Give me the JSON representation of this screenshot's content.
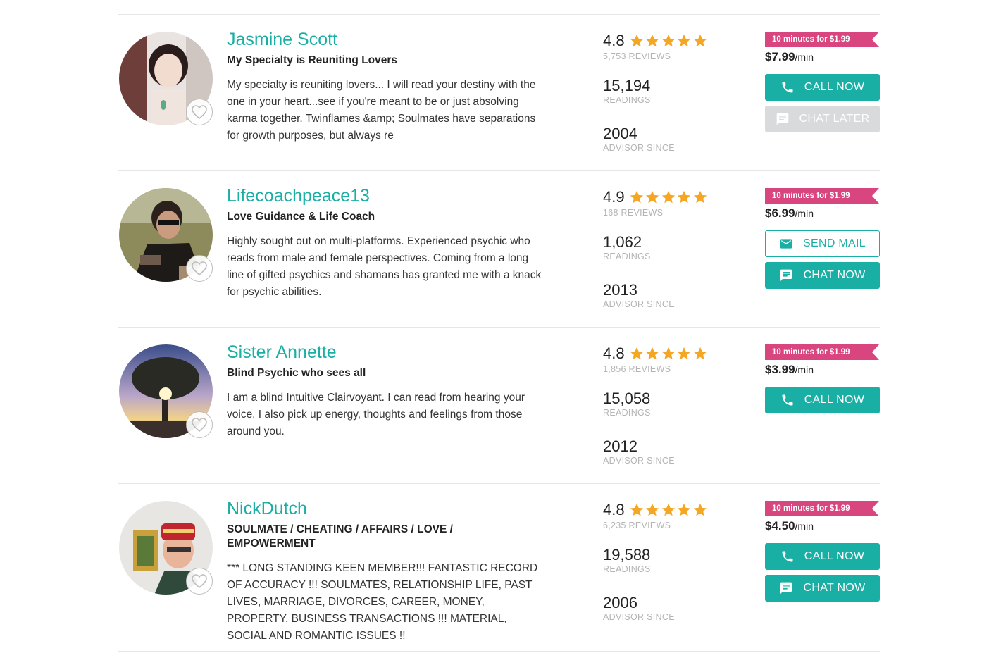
{
  "colors": {
    "accent": "#1aafa5",
    "promo": "#d9467f",
    "star": "#f5a623",
    "disabled": "#d9dadc"
  },
  "labels": {
    "reviews_suffix": "REVIEWS",
    "readings": "READINGS",
    "advisor_since": "ADVISOR SINCE",
    "per_min": "/min"
  },
  "advisors": [
    {
      "name": "Jasmine Scott",
      "specialty": "My Specialty is Reuniting Lovers",
      "description": "My specialty is reuniting lovers... I will read your destiny with the one in your heart...see if you're meant to be or just absolving karma together. Twinflames &amp; Soulmates have separations for growth purposes, but always re",
      "rating": "4.8",
      "reviews": "5,753 REVIEWS",
      "readings": "15,194",
      "since": "2004",
      "promo": "10 minutes for $1.99",
      "price": "$7.99",
      "buttons": [
        {
          "label": "CALL NOW",
          "icon": "phone-icon",
          "style": "primary"
        },
        {
          "label": "CHAT LATER",
          "icon": "chat-icon",
          "style": "disabled"
        }
      ]
    },
    {
      "name": "Lifecoachpeace13",
      "specialty": "Love Guidance & Life Coach",
      "description": "Highly sought out on multi-platforms. Experienced psychic who reads from male and female perspectives. Coming from a long line of gifted psychics and shamans has granted me with a knack for psychic abilities.",
      "rating": "4.9",
      "reviews": "168 REVIEWS",
      "readings": "1,062",
      "since": "2013",
      "promo": "10 minutes for $1.99",
      "price": "$6.99",
      "buttons": [
        {
          "label": "SEND MAIL",
          "icon": "mail-icon",
          "style": "outline"
        },
        {
          "label": "CHAT NOW",
          "icon": "chat-icon",
          "style": "primary"
        }
      ]
    },
    {
      "name": "Sister Annette",
      "specialty": "Blind Psychic who sees all",
      "description": "I am a blind Intuitive Clairvoyant. I can read from hearing your voice. I also pick up energy, thoughts and feelings from those around you.",
      "rating": "4.8",
      "reviews": "1,856 REVIEWS",
      "readings": "15,058",
      "since": "2012",
      "promo": "10 minutes for $1.99",
      "price": "$3.99",
      "buttons": [
        {
          "label": "CALL NOW",
          "icon": "phone-icon",
          "style": "primary"
        }
      ]
    },
    {
      "name": "NickDutch",
      "specialty": "SOULMATE / CHEATING / AFFAIRS / LOVE / EMPOWERMENT",
      "description": "*** LONG STANDING KEEN MEMBER!!! FANTASTIC RECORD OF ACCURACY !!! SOULMATES, RELATIONSHIP LIFE, PAST LIVES, MARRIAGE, DIVORCES, CAREER, MONEY, PROPERTY, BUSINESS TRANSACTIONS !!! MATERIAL, SOCIAL AND ROMANTIC ISSUES !!",
      "rating": "4.8",
      "reviews": "6,235 REVIEWS",
      "readings": "19,588",
      "since": "2006",
      "promo": "10 minutes for $1.99",
      "price": "$4.50",
      "buttons": [
        {
          "label": "CALL NOW",
          "icon": "phone-icon",
          "style": "primary"
        },
        {
          "label": "CHAT NOW",
          "icon": "chat-icon",
          "style": "primary"
        }
      ]
    }
  ]
}
